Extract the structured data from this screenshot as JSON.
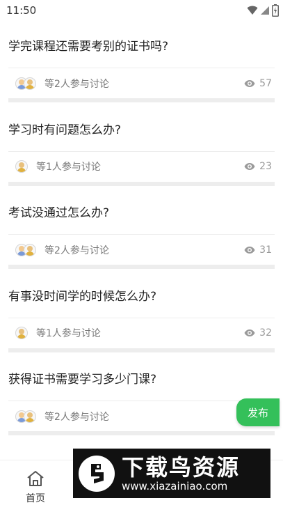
{
  "status_bar": {
    "time": "11:50",
    "icons": [
      "wifi-icon",
      "signal-icon",
      "battery-icon"
    ]
  },
  "posts": [
    {
      "title": "学完课程还需要考别的证书吗?",
      "participants": "等2人参与讨论",
      "avatar_count": 2,
      "views": "57"
    },
    {
      "title": "学习时有问题怎么办?",
      "participants": "等1人参与讨论",
      "avatar_count": 1,
      "views": "23"
    },
    {
      "title": "考试没通过怎么办?",
      "participants": "等2人参与讨论",
      "avatar_count": 2,
      "views": "31"
    },
    {
      "title": "有事没时间学的时候怎么办?",
      "participants": "等1人参与讨论",
      "avatar_count": 1,
      "views": "32"
    },
    {
      "title": "获得证书需要学习多少门课?",
      "participants": "等2人参与讨论",
      "avatar_count": 2,
      "views": ""
    }
  ],
  "publish_button": {
    "label": "发布",
    "color": "#34c05a"
  },
  "tab_bar": {
    "home_label": "首页",
    "home_icon": "home-icon"
  },
  "watermark": {
    "title": "下载鸟资源",
    "url": "www.xiazainiao.com"
  }
}
